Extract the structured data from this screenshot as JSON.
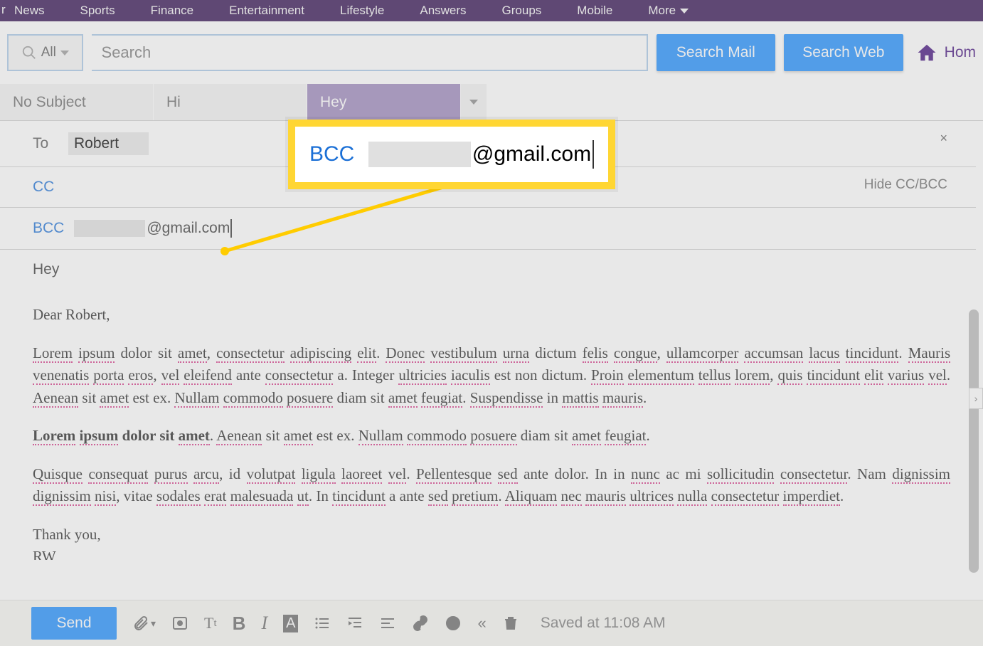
{
  "topnav": {
    "fragment": "r",
    "items": [
      "News",
      "Sports",
      "Finance",
      "Entertainment",
      "Lifestyle",
      "Answers",
      "Groups",
      "Mobile"
    ],
    "more": "More"
  },
  "search": {
    "scope": "All",
    "placeholder": "Search",
    "mail_btn": "Search Mail",
    "web_btn": "Search Web",
    "home": "Hom"
  },
  "tabs": {
    "t0": "No Subject",
    "t1": "Hi",
    "t2": "Hey"
  },
  "compose": {
    "to_label": "To",
    "to_name": "Robert",
    "cc_label": "CC",
    "bcc_label": "BCC",
    "bcc_suffix": "@gmail.com",
    "hide_label": "Hide CC/BCC",
    "subject": "Hey"
  },
  "callout": {
    "label": "BCC",
    "suffix": "@gmail.com"
  },
  "body": {
    "greeting": "Dear Robert,",
    "p1": "Lorem ipsum dolor sit amet, consectetur adipiscing elit. Donec vestibulum urna dictum felis congue, ullamcorper accumsan lacus tincidunt. Mauris venenatis porta eros, vel eleifend ante consectetur a. Integer ultricies iaculis est non dictum. Proin elementum tellus lorem, quis tincidunt elit varius vel. Aenean sit amet est ex. Nullam commodo posuere diam sit amet feugiat. Suspendisse in mattis mauris.",
    "p2": "Lorem ipsum dolor sit amet. Aenean sit amet est ex. Nullam commodo posuere diam sit amet feugiat.",
    "p3": "Quisque consequat purus arcu, id volutpat ligula laoreet vel. Pellentesque sed ante dolor. In in nunc ac mi sollicitudin consectetur. Nam dignissim dignissim nisi, vitae sodales erat malesuada ut. In tincidunt a ante sed pretium. Aliquam nec mauris ultrices nulla consectetur imperdiet.",
    "thanks": "Thank you,",
    "sig": "RW"
  },
  "bottom": {
    "send": "Send",
    "saved": "Saved at 11:08 AM"
  }
}
